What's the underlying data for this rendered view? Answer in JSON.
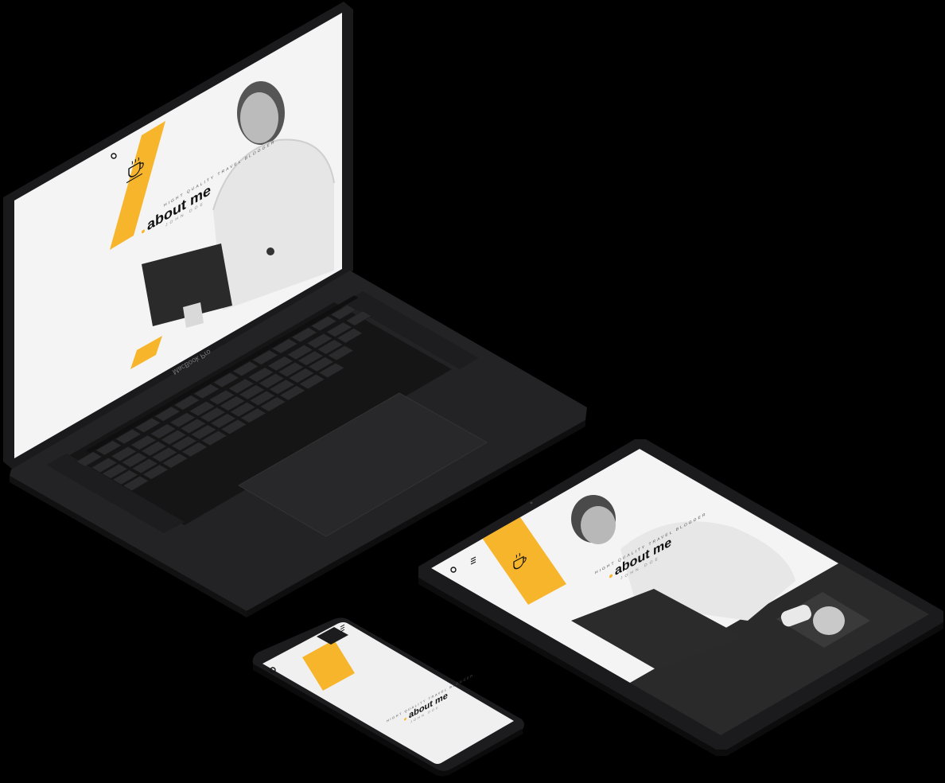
{
  "laptop": {
    "brand_text": "MacBook Pro",
    "page": {
      "title": "about me",
      "kicker": "HIGHT QUALITY TRAVEL BLOGGER",
      "subtitle": "JOHN DOE"
    }
  },
  "tablet": {
    "page": {
      "title": "about me",
      "kicker": "HIGHT QUALITY TRAVEL BLOGGER",
      "subtitle": "JOHN DOE"
    }
  },
  "phone": {
    "page": {
      "title": "about me",
      "kicker": "HIGHT QUALITY TRAVEL BLOGGER",
      "subtitle": "JOHN DOE"
    }
  },
  "colors": {
    "accent": "#f7b52b",
    "device": "#1c1c1e",
    "screen": "#f2f2f2",
    "background": "#000000"
  }
}
